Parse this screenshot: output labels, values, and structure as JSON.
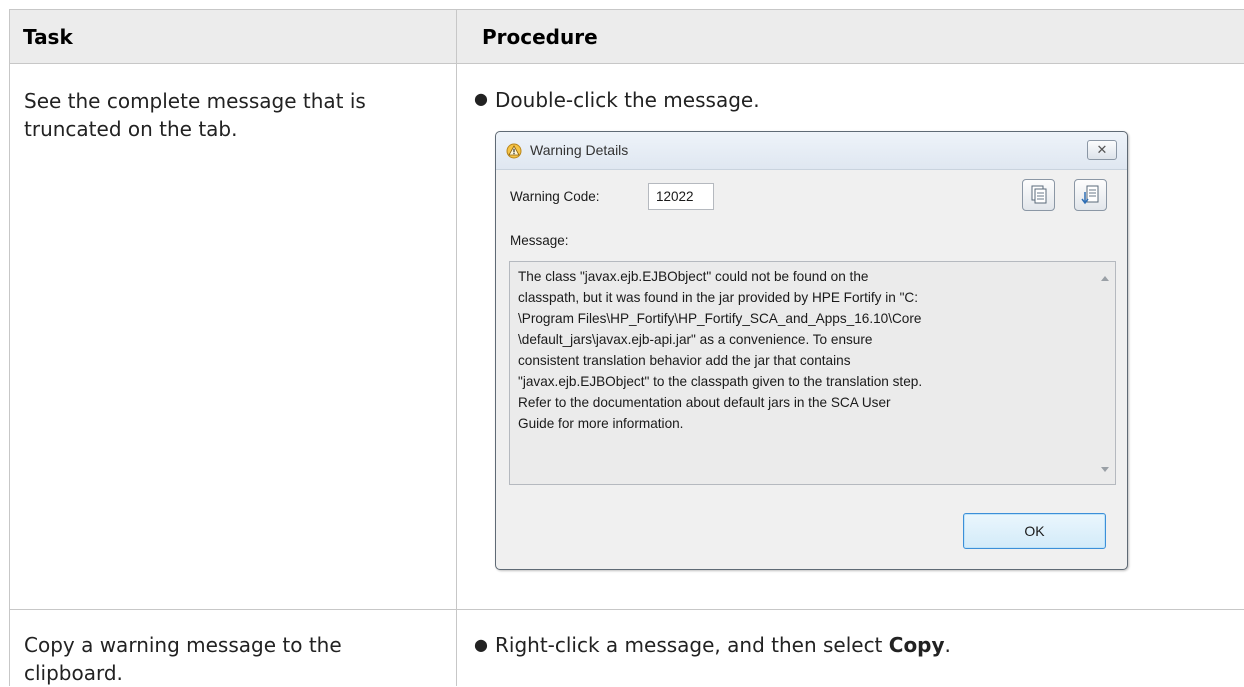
{
  "table": {
    "headers": {
      "task": "Task",
      "procedure": "Procedure"
    },
    "rows": [
      {
        "task": "See the complete message that is truncated on the tab.",
        "procedure": "Double-click the message."
      },
      {
        "task": "Copy a warning message to the clipboard.",
        "procedure_prefix": "Right-click a message, and then select ",
        "procedure_bold": "Copy",
        "procedure_suffix": "."
      }
    ]
  },
  "dialog": {
    "title": "Warning Details",
    "close_icon": "close-icon",
    "warning_icon": "warning-icon",
    "code_label": "Warning Code:",
    "code_value": "12022",
    "copy_icon": "copy-icon",
    "export_icon": "export-icon",
    "message_label": "Message:",
    "message_text": "The class \"javax.ejb.EJBObject\" could not be found on the\nclasspath, but it was found in the jar provided by HPE Fortify in \"C:\n\\Program Files\\HP_Fortify\\HP_Fortify_SCA_and_Apps_16.10\\Core\n\\default_jars\\javax.ejb-api.jar\" as a convenience. To ensure\nconsistent translation behavior add the jar that contains\n\"javax.ejb.EJBObject\" to the classpath given to the translation step.\nRefer to the documentation about default jars in the SCA User\nGuide for more information.",
    "ok_label": "OK"
  },
  "colors": {
    "header_bg": "#ececec",
    "border": "#c7c7c7",
    "ok_border": "#3c8fd8"
  }
}
